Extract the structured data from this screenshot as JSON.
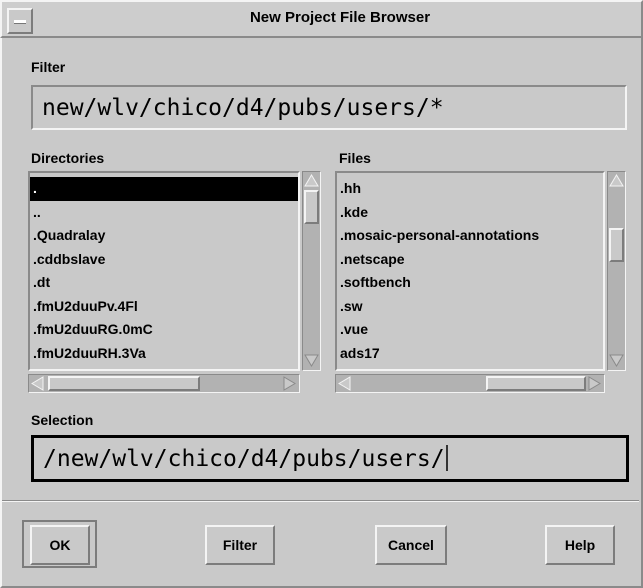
{
  "window": {
    "title": "New Project File Browser"
  },
  "filter": {
    "label": "Filter",
    "value": "new/wlv/chico/d4/pubs/users/*"
  },
  "directories": {
    "label": "Directories",
    "items": [
      ".",
      "..",
      ".Quadralay",
      ".cddbslave",
      ".dt",
      ".fmU2duuPv.4Fl",
      ".fmU2duuRG.0mC",
      ".fmU2duuRH.3Va"
    ],
    "selected_index": 0
  },
  "files": {
    "label": "Files",
    "items": [
      ".hh",
      ".kde",
      ".mosaic-personal-annotations",
      ".netscape",
      ".softbench",
      ".sw",
      ".vue",
      "ads17"
    ]
  },
  "selection": {
    "label": "Selection",
    "value": "/new/wlv/chico/d4/pubs/users/"
  },
  "buttons": {
    "ok": "OK",
    "filter": "Filter",
    "cancel": "Cancel",
    "help": "Help"
  },
  "icons": {
    "window_menu": "window-menu-icon",
    "arrows": [
      "arrow-up-icon",
      "arrow-down-icon",
      "arrow-left-icon",
      "arrow-right-icon"
    ]
  }
}
